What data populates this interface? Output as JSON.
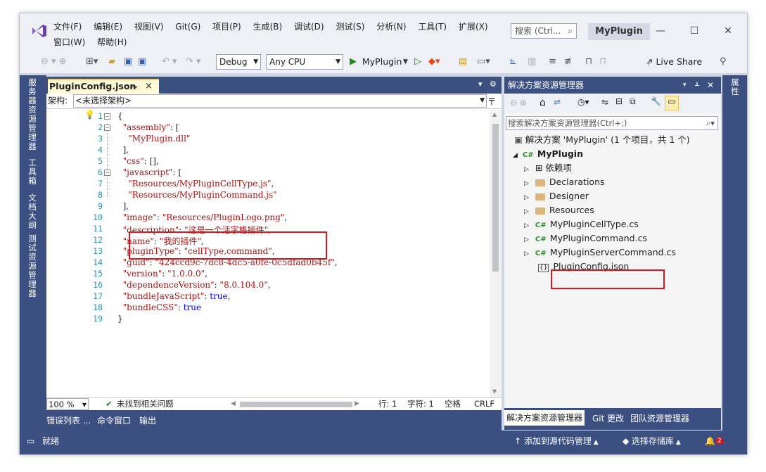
{
  "window": {
    "menu_row1": [
      "文件(F)",
      "编辑(E)",
      "视图(V)",
      "Git(G)",
      "项目(P)",
      "生成(B)",
      "调试(D)",
      "测试(S)",
      "分析(N)",
      "工具(T)",
      "扩展(X)"
    ],
    "menu_row2": [
      "窗口(W)",
      "帮助(H)"
    ],
    "search_placeholder": "搜索 (Ctrl...",
    "project_name": "MyPlugin",
    "minimize": "—",
    "maximize": "☐",
    "close": "✕"
  },
  "toolbar": {
    "config": "Debug",
    "platform": "Any CPU",
    "run_target": "MyPlugin",
    "live_share": "Live Share"
  },
  "left_strip": [
    "服务器资源管理器",
    "工具箱",
    "文档大纲",
    "测试资源管理器"
  ],
  "right_strip": [
    "属性"
  ],
  "editor": {
    "tab_title": "PluginConfig.json",
    "pin": "⊸",
    "close": "×",
    "nav_label": "架构:",
    "nav_value": "<未选择架构>",
    "lines": [
      {
        "n": "1",
        "text": "{"
      },
      {
        "n": "2",
        "text": "  \"assembly\": ["
      },
      {
        "n": "3",
        "text": "    \"MyPlugin.dll\""
      },
      {
        "n": "4",
        "text": "  ],"
      },
      {
        "n": "5",
        "text": "  \"css\": [],"
      },
      {
        "n": "6",
        "text": "  \"javascript\": ["
      },
      {
        "n": "7",
        "text": "    \"Resources/MyPluginCellType.js\","
      },
      {
        "n": "8",
        "text": "    \"Resources/MyPluginCommand.js\""
      },
      {
        "n": "9",
        "text": "  ],"
      },
      {
        "n": "10",
        "text": "  \"image\": \"Resources/PluginLogo.png\","
      },
      {
        "n": "11",
        "text": "  \"description\": \"这是一个活字格插件\","
      },
      {
        "n": "12",
        "text": "  \"name\": \"我的插件\","
      },
      {
        "n": "13",
        "text": "  \"pluginType\": \"cellType,command\","
      },
      {
        "n": "14",
        "text": "  \"guid\": \"424ccd9c-7dc8-4dc5-a0fe-0c5dfad0b45f\","
      },
      {
        "n": "15",
        "text": "  \"version\": \"1.0.0.0\","
      },
      {
        "n": "16",
        "text": "  \"dependenceVersion\": \"8.0.104.0\","
      },
      {
        "n": "17",
        "text": "  \"bundleJavaScript\": true,"
      },
      {
        "n": "18",
        "text": "  \"bundleCSS\": true"
      },
      {
        "n": "19",
        "text": "}"
      }
    ],
    "zoom": "100 %",
    "issues": "未找到相关问题",
    "line_pos": "行: 1",
    "char_pos": "字符: 1",
    "spacing": "空格",
    "eol": "CRLF"
  },
  "bottom_tabs": [
    "错误列表 ...",
    "命令窗口",
    "输出"
  ],
  "solution_explorer": {
    "title": "解决方案资源管理器",
    "search_placeholder": "搜索解决方案资源管理器(Ctrl+;)",
    "solution_label": "解决方案 'MyPlugin' (1 个项目，共 1 个)",
    "project": "MyPlugin",
    "items": [
      {
        "label": "依赖项",
        "icon": "dependencies-icon"
      },
      {
        "label": "Declarations",
        "icon": "folder-icon"
      },
      {
        "label": "Designer",
        "icon": "folder-icon"
      },
      {
        "label": "Resources",
        "icon": "folder-icon"
      },
      {
        "label": "MyPluginCellType.cs",
        "icon": "csharp-file-icon"
      },
      {
        "label": "MyPluginCommand.cs",
        "icon": "csharp-file-icon"
      },
      {
        "label": "MyPluginServerCommand.cs",
        "icon": "csharp-file-icon"
      },
      {
        "label": "PluginConfig.json",
        "icon": "json-file-icon"
      }
    ],
    "tabs": [
      "解决方案资源管理器",
      "Git 更改",
      "团队资源管理器"
    ]
  },
  "status": {
    "ready": "就绪",
    "add_source": "添加到源代码管理",
    "select_repo": "选择存储库",
    "notifications": "2"
  },
  "colors": {
    "accent": "#3b4f81",
    "highlight_box": "#d9161c",
    "tab_active": "#fef9d5",
    "json_key": "#a31515",
    "json_literal": "#0000ff"
  }
}
